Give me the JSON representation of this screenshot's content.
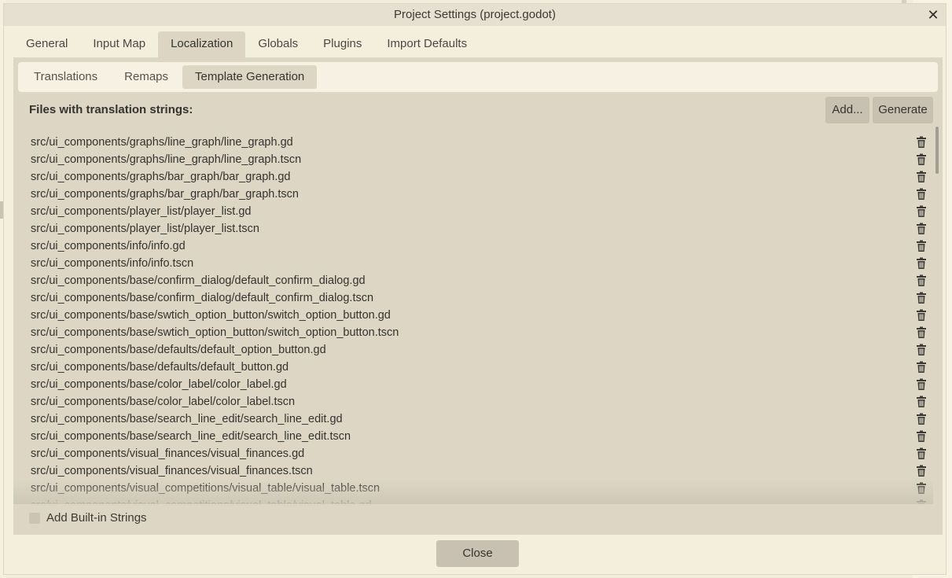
{
  "window": {
    "title": "Project Settings (project.godot)",
    "close_glyph": "✕"
  },
  "main_tabs": [
    {
      "label": "General"
    },
    {
      "label": "Input Map"
    },
    {
      "label": "Localization"
    },
    {
      "label": "Globals"
    },
    {
      "label": "Plugins"
    },
    {
      "label": "Import Defaults"
    }
  ],
  "active_main_tab": "Localization",
  "sub_tabs": [
    {
      "label": "Translations"
    },
    {
      "label": "Remaps"
    },
    {
      "label": "Template Generation"
    }
  ],
  "active_sub_tab": "Template Generation",
  "template_generation": {
    "files_label": "Files with translation strings:",
    "add_button": "Add...",
    "generate_button": "Generate",
    "files": [
      "src/ui_components/graphs/line_graph/line_graph.gd",
      "src/ui_components/graphs/line_graph/line_graph.tscn",
      "src/ui_components/graphs/bar_graph/bar_graph.gd",
      "src/ui_components/graphs/bar_graph/bar_graph.tscn",
      "src/ui_components/player_list/player_list.gd",
      "src/ui_components/player_list/player_list.tscn",
      "src/ui_components/info/info.gd",
      "src/ui_components/info/info.tscn",
      "src/ui_components/base/confirm_dialog/default_confirm_dialog.gd",
      "src/ui_components/base/confirm_dialog/default_confirm_dialog.tscn",
      "src/ui_components/base/swtich_option_button/switch_option_button.gd",
      "src/ui_components/base/swtich_option_button/switch_option_button.tscn",
      "src/ui_components/base/defaults/default_option_button.gd",
      "src/ui_components/base/defaults/default_button.gd",
      "src/ui_components/base/color_label/color_label.gd",
      "src/ui_components/base/color_label/color_label.tscn",
      "src/ui_components/base/search_line_edit/search_line_edit.gd",
      "src/ui_components/base/search_line_edit/search_line_edit.tscn",
      "src/ui_components/visual_finances/visual_finances.gd",
      "src/ui_components/visual_finances/visual_finances.tscn",
      "src/ui_components/visual_competitions/visual_table/visual_table.tscn",
      "src/ui_components/visual_competitions/visual_table/visual_table.gd"
    ],
    "row_icon": "trash-icon",
    "builtin_checkbox_label": "Add Built-in Strings",
    "builtin_checked": false
  },
  "footer": {
    "close_button": "Close"
  },
  "colors": {
    "dialog_bg": "#f4eedd",
    "panel_bg": "#ddd6c5",
    "button_bg": "#c8c1b1",
    "text": "#33322d"
  }
}
